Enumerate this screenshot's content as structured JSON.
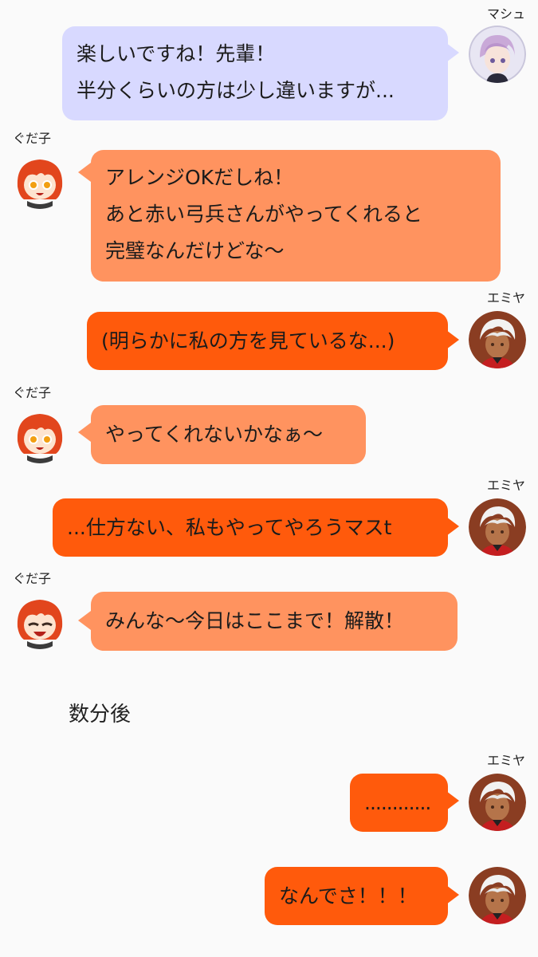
{
  "colors": {
    "background": "#fafafa",
    "mash_bubble": "#d8d9ff",
    "gudako_bubble": "#ff935f",
    "emiya_bubble": "#ff5a0c"
  },
  "messages": [
    {
      "speaker": "マシュ",
      "icon": "mash-avatar-icon",
      "lines": [
        "楽しいですね！先輩！",
        "半分くらいの方は少し違いますが..."
      ]
    },
    {
      "speaker": "ぐだ子",
      "icon": "gudako-avatar-icon",
      "lines": [
        "アレンジOKだしね！",
        "あと赤い弓兵さんがやってくれると",
        "完璧なんだけどな〜"
      ]
    },
    {
      "speaker": "エミヤ",
      "icon": "emiya-avatar-icon",
      "lines": [
        "(明らかに私の方を見ているな...)"
      ]
    },
    {
      "speaker": "ぐだ子",
      "icon": "gudako-avatar-icon",
      "lines": [
        "やってくれないかなぁ〜"
      ]
    },
    {
      "speaker": "エミヤ",
      "icon": "emiya-avatar-icon",
      "lines": [
        "...仕方ない、私もやってやろうマスt"
      ]
    },
    {
      "speaker": "ぐだ子",
      "icon": "gudako-avatar-icon",
      "lines": [
        "みんな〜今日はここまで！解散！"
      ]
    },
    {
      "speaker": "エミヤ",
      "icon": "emiya-avatar-icon",
      "lines": [
        "............"
      ]
    },
    {
      "speaker": "エミヤ",
      "icon": "emiya-avatar-icon",
      "lines": [
        "なんでさ！！！"
      ]
    }
  ],
  "narration": "数分後"
}
